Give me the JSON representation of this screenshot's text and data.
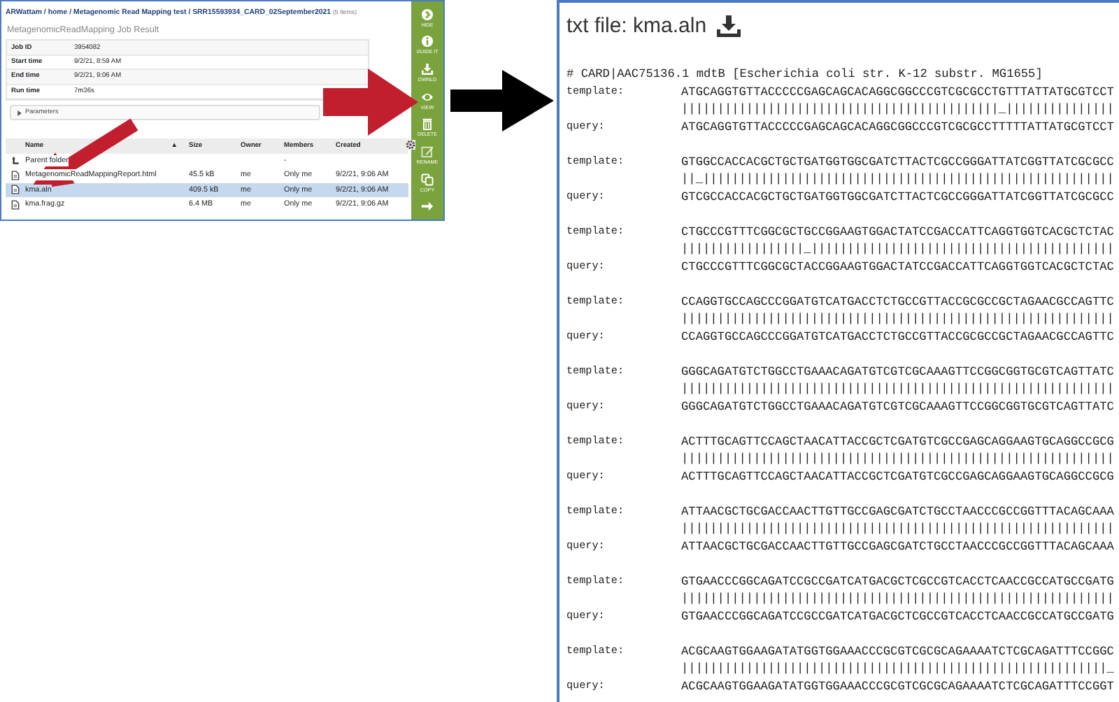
{
  "breadcrumb": {
    "separator": "/",
    "items": [
      "ARWattam",
      "home",
      "Metagenomic Read Mapping test",
      "SRR15593934_CARD_02September2021"
    ],
    "item_count": "(5 items)"
  },
  "job_result": {
    "title": "MetagenomicReadMapping Job Result",
    "fields": [
      {
        "label": "Job ID",
        "value": "3954082"
      },
      {
        "label": "Start time",
        "value": "9/2/21, 8:59 AM"
      },
      {
        "label": "End time",
        "value": "9/2/21, 9:06 AM"
      },
      {
        "label": "Run time",
        "value": "7m36s"
      }
    ],
    "parameters": {
      "label": "Parameters",
      "expanded": false
    }
  },
  "files": {
    "columns": [
      {
        "label": "Name",
        "sort": "▲"
      },
      {
        "label": "Size"
      },
      {
        "label": "Owner"
      },
      {
        "label": "Members"
      },
      {
        "label": "Created"
      }
    ],
    "rows": [
      {
        "kind": "parent",
        "name": "Parent folder",
        "members": "-",
        "selected": false
      },
      {
        "kind": "file",
        "name": "MetagenomicReadMappingReport.html",
        "size": "45.5 kB",
        "owner": "me",
        "members": "Only me",
        "created": "9/2/21, 9:06 AM",
        "selected": false
      },
      {
        "kind": "file",
        "name": "kma.aln",
        "size": "409.5 kB",
        "owner": "me",
        "members": "Only me",
        "created": "9/2/21, 9:06 AM",
        "selected": true
      },
      {
        "kind": "file",
        "name": "kma.frag.gz",
        "size": "6.4 MB",
        "owner": "me",
        "members": "Only me",
        "created": "9/2/21, 9:06 AM",
        "selected": false
      }
    ]
  },
  "action_bar": [
    {
      "kind": "hide",
      "label": "HIDE"
    },
    {
      "kind": "guide",
      "label": "GUIDE IT"
    },
    {
      "kind": "download",
      "label": "DWNLD"
    },
    {
      "kind": "view",
      "label": "VIEW"
    },
    {
      "kind": "delete",
      "label": "DELETE"
    },
    {
      "kind": "rename",
      "label": "RENAME"
    },
    {
      "kind": "copy",
      "label": "COPY"
    },
    {
      "kind": "next"
    }
  ],
  "viewer": {
    "title": "txt file: kma.aln",
    "header": "# CARD|AAC75136.1 mdtB [Escherichia coli str. K-12 substr. MG1655]",
    "blocks": [
      {
        "template_label": "template:",
        "template": "ATGCAGGTGTTACCCCCGAGCAGCACAGGCGGCCCGTCGCGCCTGTTTATTATGCGTCCT",
        "match": "||||||||||||||||||||||||||||||||||||||||||||_|||||||||||||||",
        "query_label": "query:",
        "query": "ATGCAGGTGTTACCCCCGAGCAGCACAGGCGGCCCGTCGCGCCTTTTTATTATGCGTCCT"
      },
      {
        "template_label": "template:",
        "template": "GTGGCCACCACGCTGCTGATGGTGGCGATCTTACTCGCCGGGATTATCGGTTATCGCGCC",
        "match": "||_|||||||||||||||||||||||||||||||||||||||||||||||||||||||||",
        "query_label": "query:",
        "query": "GTCGCCACCACGCTGCTGATGGTGGCGATCTTACTCGCCGGGATTATCGGTTATCGCGCC"
      },
      {
        "template_label": "template:",
        "template": "CTGCCCGTTTCGGCGCTGCCGGAAGTGGACTATCCGACCATTCAGGTGGTCACGCTCTAC",
        "match": "|||||||||||||||||_||||||||||||||||||||||||||||||||||||||||||",
        "query_label": "query:",
        "query": "CTGCCCGTTTCGGCGCTACCGGAAGTGGACTATCCGACCATTCAGGTGGTCACGCTCTAC"
      },
      {
        "template_label": "template:",
        "template": "CCAGGTGCCAGCCCGGATGTCATGACCTCTGCCGTTACCGCGCCGCTAGAACGCCAGTTC",
        "match": "||||||||||||||||||||||||||||||||||||||||||||||||||||||||||||",
        "query_label": "query:",
        "query": "CCAGGTGCCAGCCCGGATGTCATGACCTCTGCCGTTACCGCGCCGCTAGAACGCCAGTTC"
      },
      {
        "template_label": "template:",
        "template": "GGGCAGATGTCTGGCCTGAAACAGATGTCGTCGCAAAGTTCCGGCGGTGCGTCAGTTATC",
        "match": "||||||||||||||||||||||||||||||||||||||||||||||||||||||||||||",
        "query_label": "query:",
        "query": "GGGCAGATGTCTGGCCTGAAACAGATGTCGTCGCAAAGTTCCGGCGGTGCGTCAGTTATC"
      },
      {
        "template_label": "template:",
        "template": "ACTTTGCAGTTCCAGCTAACATTACCGCTCGATGTCGCCGAGCAGGAAGTGCAGGCCGCG",
        "match": "||||||||||||||||||||||||||||||||||||||||||||||||||||||||||||",
        "query_label": "query:",
        "query": "ACTTTGCAGTTCCAGCTAACATTACCGCTCGATGTCGCCGAGCAGGAAGTGCAGGCCGCG"
      },
      {
        "template_label": "template:",
        "template": "ATTAACGCTGCGACCAACTTGTTGCCGAGCGATCTGCCTAACCCGCCGGTTTACAGCAAA",
        "match": "||||||||||||||||||||||||||||||||||||||||||||||||||||||||||||",
        "query_label": "query:",
        "query": "ATTAACGCTGCGACCAACTTGTTGCCGAGCGATCTGCCTAACCCGCCGGTTTACAGCAAA"
      },
      {
        "template_label": "template:",
        "template": "GTGAACCCGGCAGATCCGCCGATCATGACGCTCGCCGTCACCTCAACCGCCATGCCGATG",
        "match": "||||||||||||||||||||||||||||||||||||||||||||||||||||||||||||",
        "query_label": "query:",
        "query": "GTGAACCCGGCAGATCCGCCGATCATGACGCTCGCCGTCACCTCAACCGCCATGCCGATG"
      },
      {
        "template_label": "template:",
        "template": "ACGCAAGTGGAAGATATGGTGGAAACCCGCGTCGCGCAGAAAATCTCGCAGATTTCCGGC",
        "match": "|||||||||||||||||||||||||||||||||||||||||||||||||||||||||||_",
        "query_label": "query:",
        "query": "ACGCAAGTGGAAGATATGGTGGAAACCCGCGTCGCGCAGAAAATCTCGCAGATTTCCGGT"
      }
    ]
  }
}
